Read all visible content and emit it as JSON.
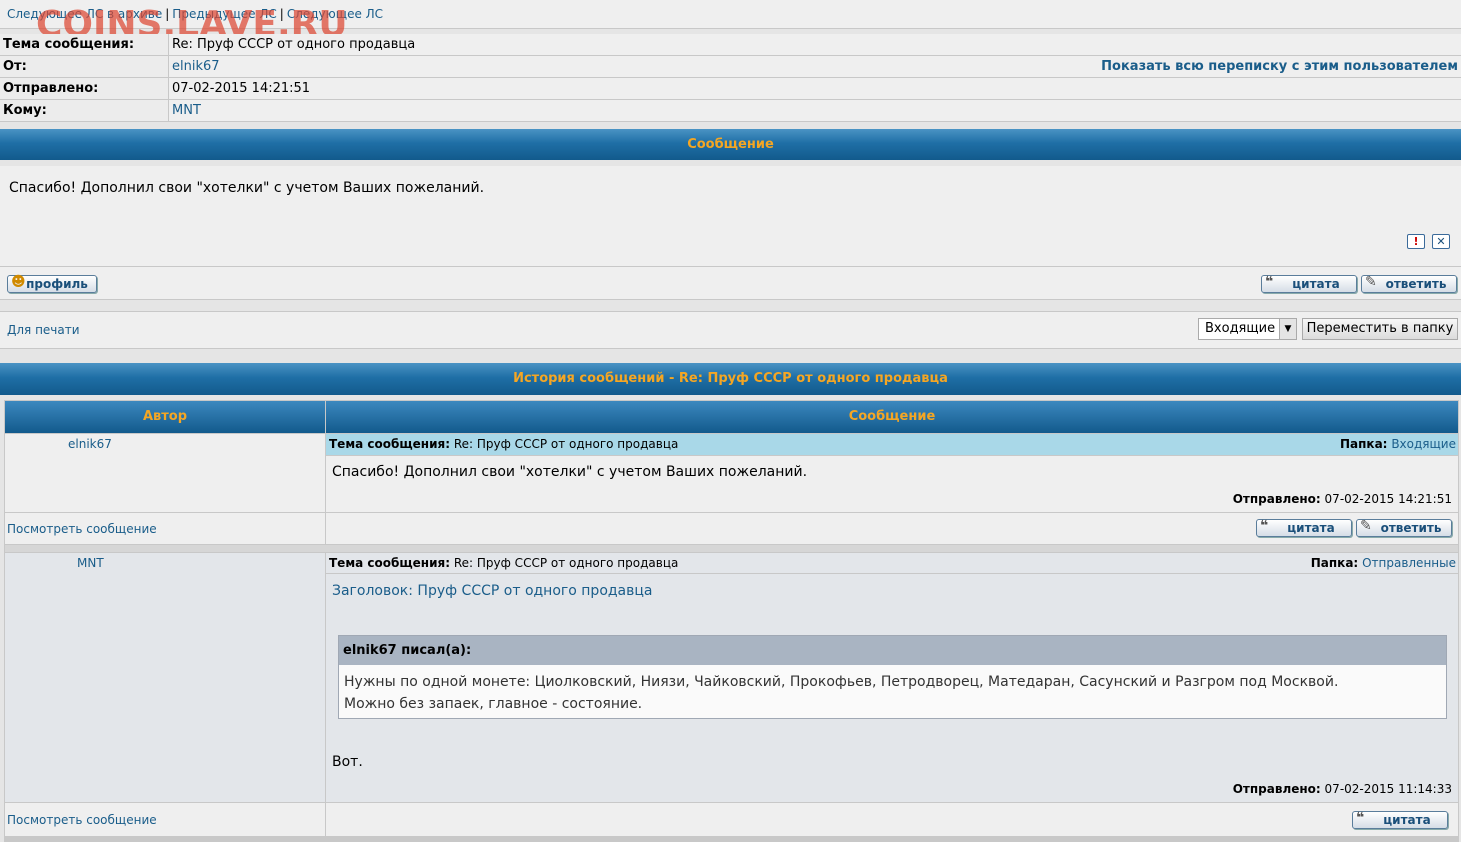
{
  "watermark": "COINS.LAVE.RU",
  "nav": {
    "next_archive": "Следующее ЛС в архиве",
    "prev": "Предыдущее ЛС",
    "next": "Следующее ЛС"
  },
  "header": {
    "subject_label": "Тема сообщения:",
    "subject_value": "Re: Пруф СССР от одного продавца",
    "from_label": "От:",
    "from_value": "elnik67",
    "show_all_link": "Показать всю переписку с этим пользователем",
    "sent_label": "Отправлено:",
    "sent_value": "07-02-2015 14:21:51",
    "to_label": "Кому:",
    "to_value": "MNT"
  },
  "message_bar": "Сообщение",
  "message_body": "Спасибо! Дополнил свои \"хотелки\" с учетом Ваших пожеланий.",
  "icons": {
    "report": "!",
    "delete": "✕"
  },
  "buttons": {
    "profile": "профиль",
    "quote": "цитата",
    "reply": "ответить"
  },
  "print_link": "Для печати",
  "folder_select": "Входящие",
  "move_button": "Переместить в папку",
  "history": {
    "title": "История сообщений - Re: Пруф СССР от одного продавца",
    "col_author": "Автор",
    "col_message": "Сообщение",
    "entries": [
      {
        "author": "elnik67",
        "subject_label": "Тема сообщения:",
        "subject": "Re: Пруф СССР от одного продавца",
        "folder_label": "Папка:",
        "folder": "Входящие",
        "body": "Спасибо! Дополнил свои \"хотелки\" с учетом Ваших пожеланий.",
        "sent_label": "Отправлено:",
        "sent": "07-02-2015 14:21:51",
        "view_link": "Посмотреть сообщение"
      },
      {
        "author": "MNT",
        "subject_label": "Тема сообщения:",
        "subject": "Re: Пруф СССР от одного продавца",
        "folder_label": "Папка:",
        "folder": "Отправленные",
        "heading": "Заголовок: Пруф СССР от одного продавца",
        "quote_author": "elnik67 писал(а):",
        "quote_line1": "Нужны по одной монете: Циолковский, Ниязи, Чайковский, Прокофьев, Петродворец, Матедаран, Сасунский и Разгром под Москвой.",
        "quote_line2": "Можно без запаек, главное - состояние.",
        "body": "Вот.",
        "sent_label": "Отправлено:",
        "sent": "07-02-2015 11:14:33",
        "view_link": "Посмотреть сообщение"
      }
    ]
  }
}
